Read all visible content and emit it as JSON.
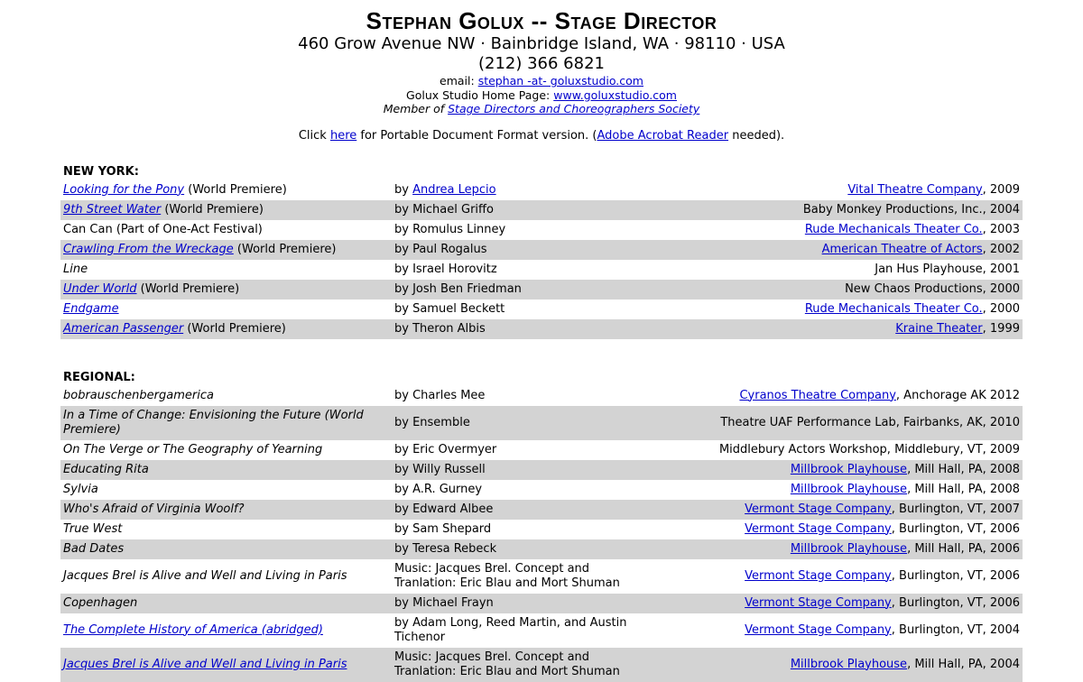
{
  "header": {
    "title": "Stephan Golux -- Stage Director",
    "address": "460 Grow Avenue NW · Bainbridge Island, WA · 98110 · USA",
    "phone": "(212) 366 6821",
    "email_label": "email:",
    "email_link": "stephan -at- goluxstudio.com",
    "homepage_label": "Golux Studio Home Page:",
    "homepage_link": "www.goluxstudio.com",
    "member_label": "Member of",
    "member_link": "Stage Directors and Choreographers Society",
    "pdf_prefix": "Click",
    "pdf_link": "here",
    "pdf_middle": "for Portable Document Format version. (",
    "acrobat_link": "Adobe Acrobat Reader",
    "pdf_suffix": "needed)."
  },
  "sections": [
    {
      "title": "NEW YORK:",
      "rows": [
        {
          "play": "Looking for the Pony",
          "play_link": true,
          "note": "(World Premiere)",
          "by": "by",
          "author": "Andrea Lepcio",
          "author_link": true,
          "theater": "Vital Theatre Company",
          "theater_link": true,
          "suffix": ", 2009"
        },
        {
          "play": "9th Street Water",
          "play_link": true,
          "note": "(World Premiere)",
          "by": "by Michael Griffo",
          "author": "",
          "author_link": false,
          "theater": "Baby Monkey Productions, Inc., 2004",
          "theater_link": false,
          "suffix": ""
        },
        {
          "play": "Can Can",
          "play_link": false,
          "play_plain": true,
          "note": "(Part of One-Act Festival)",
          "by": "by Romulus Linney",
          "author": "",
          "author_link": false,
          "theater": "Rude Mechanicals Theater Co.",
          "theater_link": true,
          "suffix": ", 2003"
        },
        {
          "play": "Crawling From the Wreckage",
          "play_link": true,
          "note": "(World Premiere)",
          "by": "by Paul Rogalus",
          "author": "",
          "author_link": false,
          "theater": "American Theatre of Actors",
          "theater_link": true,
          "suffix": ", 2002"
        },
        {
          "play": "Line",
          "play_link": false,
          "note": "",
          "by": "by Israel Horovitz",
          "author": "",
          "author_link": false,
          "theater": "Jan Hus Playhouse, 2001",
          "theater_link": false,
          "suffix": ""
        },
        {
          "play": "Under World",
          "play_link": true,
          "note": "(World Premiere)",
          "by": "by Josh Ben Friedman",
          "author": "",
          "author_link": false,
          "theater": "New Chaos Productions, 2000",
          "theater_link": false,
          "suffix": ""
        },
        {
          "play": "Endgame",
          "play_link": true,
          "note": "",
          "by": "by Samuel Beckett",
          "author": "",
          "author_link": false,
          "theater": "Rude Mechanicals Theater Co.",
          "theater_link": true,
          "suffix": ", 2000"
        },
        {
          "play": "American Passenger",
          "play_link": true,
          "note": "(World Premiere)",
          "by": "by Theron Albis",
          "author": "",
          "author_link": false,
          "theater": "Kraine Theater",
          "theater_link": true,
          "suffix": ", 1999"
        }
      ]
    },
    {
      "title": "REGIONAL:",
      "rows": [
        {
          "play": "bobrauschenbergamerica",
          "play_link": false,
          "note": "",
          "by": "by Charles Mee",
          "author": "",
          "author_link": false,
          "theater": "Cyranos Theatre Company",
          "theater_link": true,
          "suffix": ", Anchorage AK 2012"
        },
        {
          "play": "In a Time of Change: Envisioning the Future (World Premiere)",
          "play_link": false,
          "note": "",
          "by": "by Ensemble",
          "author": "",
          "author_link": false,
          "theater": "Theatre UAF Performance Lab, Fairbanks, AK, 2010",
          "theater_link": false,
          "suffix": ""
        },
        {
          "play": "On The Verge or The Geography of Yearning",
          "play_link": false,
          "note": "",
          "by": "by Eric Overmyer",
          "author": "",
          "author_link": false,
          "theater": "Middlebury Actors Workshop, Middlebury, VT, 2009",
          "theater_link": false,
          "suffix": ""
        },
        {
          "play": "Educating Rita",
          "play_link": false,
          "note": "",
          "by": "by Willy Russell",
          "author": "",
          "author_link": false,
          "theater": "Millbrook Playhouse",
          "theater_link": true,
          "suffix": ", Mill Hall, PA, 2008"
        },
        {
          "play": "Sylvia",
          "play_link": false,
          "note": "",
          "by": "by A.R. Gurney",
          "author": "",
          "author_link": false,
          "theater": "Millbrook Playhouse",
          "theater_link": true,
          "suffix": ", Mill Hall, PA, 2008"
        },
        {
          "play": "Who's Afraid of Virginia Woolf?",
          "play_link": false,
          "note": "",
          "by": "by Edward Albee",
          "author": "",
          "author_link": false,
          "theater": "Vermont Stage Company",
          "theater_link": true,
          "suffix": ", Burlington, VT, 2007"
        },
        {
          "play": "True West",
          "play_link": false,
          "note": "",
          "by": "by Sam Shepard",
          "author": "",
          "author_link": false,
          "theater": "Vermont Stage Company",
          "theater_link": true,
          "suffix": ", Burlington, VT, 2006"
        },
        {
          "play": "Bad Dates",
          "play_link": false,
          "note": "",
          "by": "by Teresa Rebeck",
          "author": "",
          "author_link": false,
          "theater": "Millbrook Playhouse",
          "theater_link": true,
          "suffix": ", Mill Hall, PA, 2006"
        },
        {
          "play": "Jacques Brel is Alive and Well and Living in Paris",
          "play_link": false,
          "note": "",
          "by": "Music: Jacques Brel. Concept and Tranlation: Eric Blau and Mort Shuman",
          "author": "",
          "author_link": false,
          "theater": "Vermont Stage Company",
          "theater_link": true,
          "suffix": ", Burlington, VT, 2006"
        },
        {
          "play": "Copenhagen",
          "play_link": false,
          "note": "",
          "by": "by Michael Frayn",
          "author": "",
          "author_link": false,
          "theater": "Vermont Stage Company",
          "theater_link": true,
          "suffix": ", Burlington, VT, 2006"
        },
        {
          "play": "The Complete History of America (abridged)",
          "play_link": true,
          "note": "",
          "by": "by Adam Long, Reed Martin, and Austin Tichenor",
          "author": "",
          "author_link": false,
          "theater": "Vermont Stage Company",
          "theater_link": true,
          "suffix": ", Burlington, VT, 2004"
        },
        {
          "play": "Jacques Brel is Alive and Well and Living in Paris",
          "play_link": true,
          "note": "",
          "by": "Music: Jacques Brel. Concept and Tranlation: Eric Blau and Mort Shuman",
          "author": "",
          "author_link": false,
          "theater": "Millbrook Playhouse",
          "theater_link": true,
          "suffix": ", Mill Hall, PA, 2004"
        }
      ]
    }
  ]
}
